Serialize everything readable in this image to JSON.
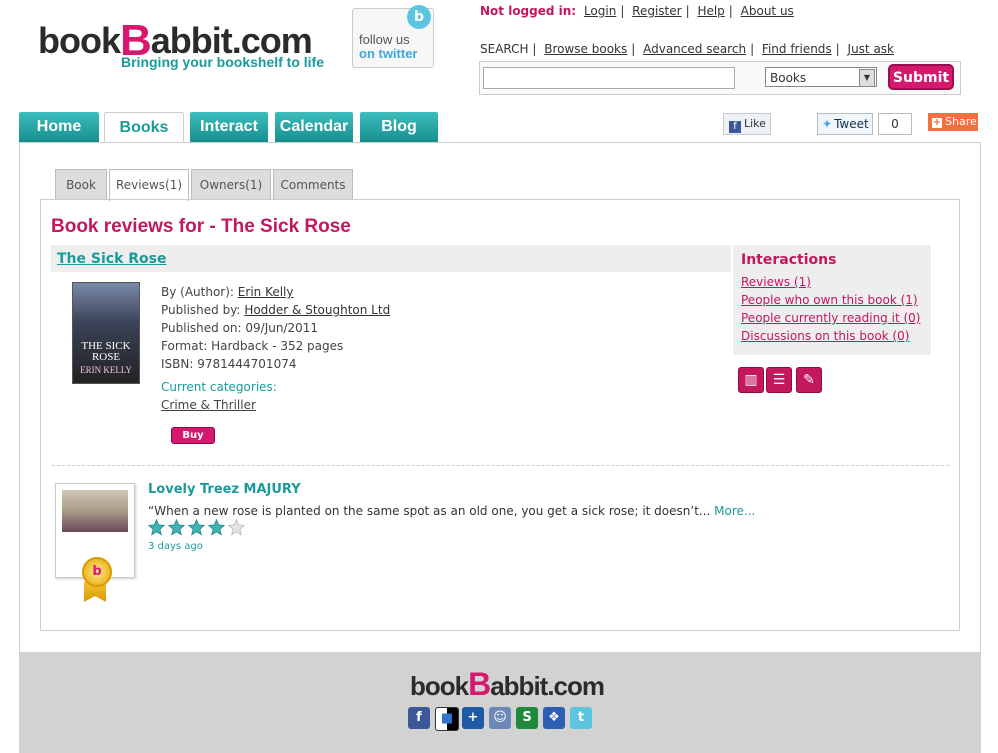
{
  "header": {
    "logo_text_pre": "book",
    "logo_text_b": "B",
    "logo_text_post": "abbit.com",
    "tagline": "Bringing your bookshelf to life",
    "follow_line1": "follow us",
    "follow_line2": "on twitter",
    "login_status": "Not logged in:",
    "top_links": [
      "Login",
      "Register",
      "Help",
      "About us"
    ],
    "search_label": "SEARCH",
    "search_links": [
      "Browse books",
      "Advanced search",
      "Find friends",
      "Just ask"
    ],
    "search_value": "",
    "search_category": "Books",
    "submit_label": "Submit"
  },
  "nav": {
    "tabs": [
      "Home",
      "Books",
      "Interact",
      "Calendar",
      "Blog"
    ],
    "active": "Books"
  },
  "social_top": {
    "like_label": "Like",
    "tweet_label": "Tweet",
    "tweet_count": "0",
    "share_label": "Share"
  },
  "subtabs": {
    "items": [
      "Book",
      "Reviews(1)",
      "Owners(1)",
      "Comments"
    ],
    "active": "Reviews(1)"
  },
  "page": {
    "title": "Book reviews for - The Sick Rose"
  },
  "book": {
    "title": "The Sick Rose",
    "cover_title": "THE SICK ROSE",
    "cover_author": "ERIN KELLY",
    "author_label": "By (Author):",
    "author": "Erin Kelly",
    "publisher_label": "Published by:",
    "publisher": "Hodder & Stoughton Ltd",
    "published_on": "Published on: 09/Jun/2011",
    "format": "Format: Hardback - 352 pages",
    "isbn": "ISBN: 9781444701074",
    "categories_label": "Current categories:",
    "category": "Crime & Thriller",
    "buy_label": "Buy"
  },
  "interactions": {
    "title": "Interactions",
    "links": [
      "Reviews (1)",
      "People who own this book (1)",
      "People currently reading it (0)",
      "Discussions on this book (0)"
    ]
  },
  "review": {
    "reviewer": "Lovely Treez MAJURY",
    "excerpt": "“When a new rose is planted on the same spot as an old one, you get a sick rose; it doesn’t...",
    "more_label": "More...",
    "rating": 4,
    "rating_max": 5,
    "time_ago": "3 days ago"
  },
  "footer": {
    "logo_pre": "book",
    "logo_b": "B",
    "logo_post": "abbit.com",
    "social_icons": [
      "facebook-icon",
      "delicious-icon",
      "myspace-icon",
      "reddit-icon",
      "stumbleupon-icon",
      "windows-live-icon",
      "twitter-icon"
    ]
  },
  "colors": {
    "brand_pink": "#d6186e",
    "brand_teal": "#1a9a9a",
    "star_teal": "#3fb3b3"
  }
}
